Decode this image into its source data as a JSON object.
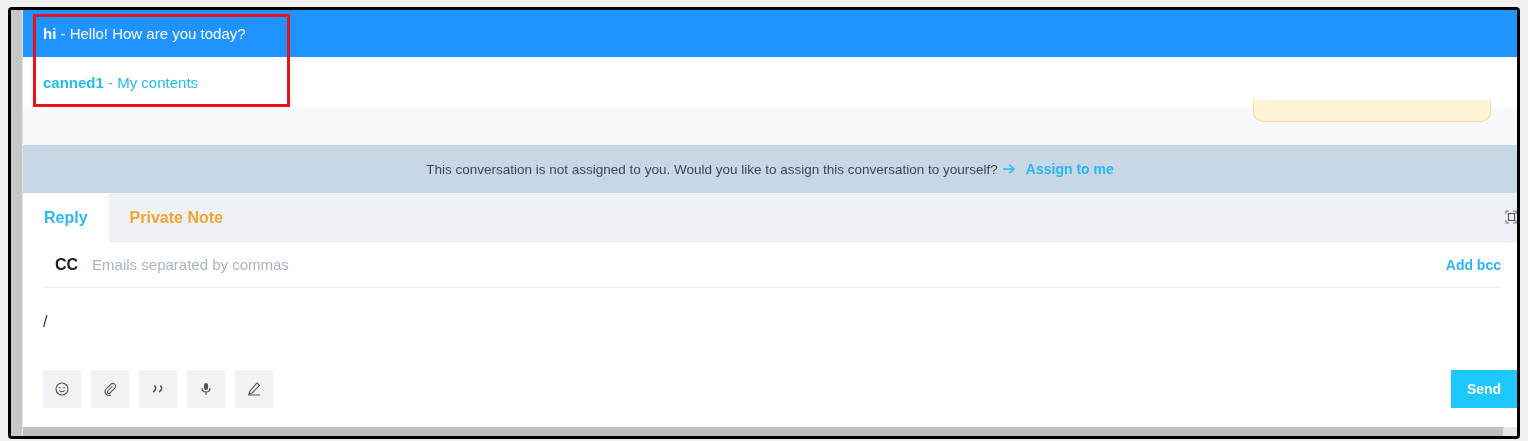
{
  "canned_responses": [
    {
      "text": "**hi** - Hello! How are you today?",
      "selected": true
    },
    {
      "text": "**canned1** - My contents",
      "selected": false
    }
  ],
  "assign_banner": {
    "message": "This conversation is not assigned to you. Would you like to assign this conversation to yourself?",
    "link": "Assign to me"
  },
  "tabs": [
    {
      "label": "Reply",
      "selected": true,
      "kind": "reply"
    },
    {
      "label": "Private Note",
      "selected": false,
      "kind": "note"
    }
  ],
  "cc": {
    "label": "CC",
    "placeholder": "Emails separated by commas",
    "action": "Add bcc"
  },
  "editor": {
    "value": "/"
  },
  "send_button": "Send"
}
